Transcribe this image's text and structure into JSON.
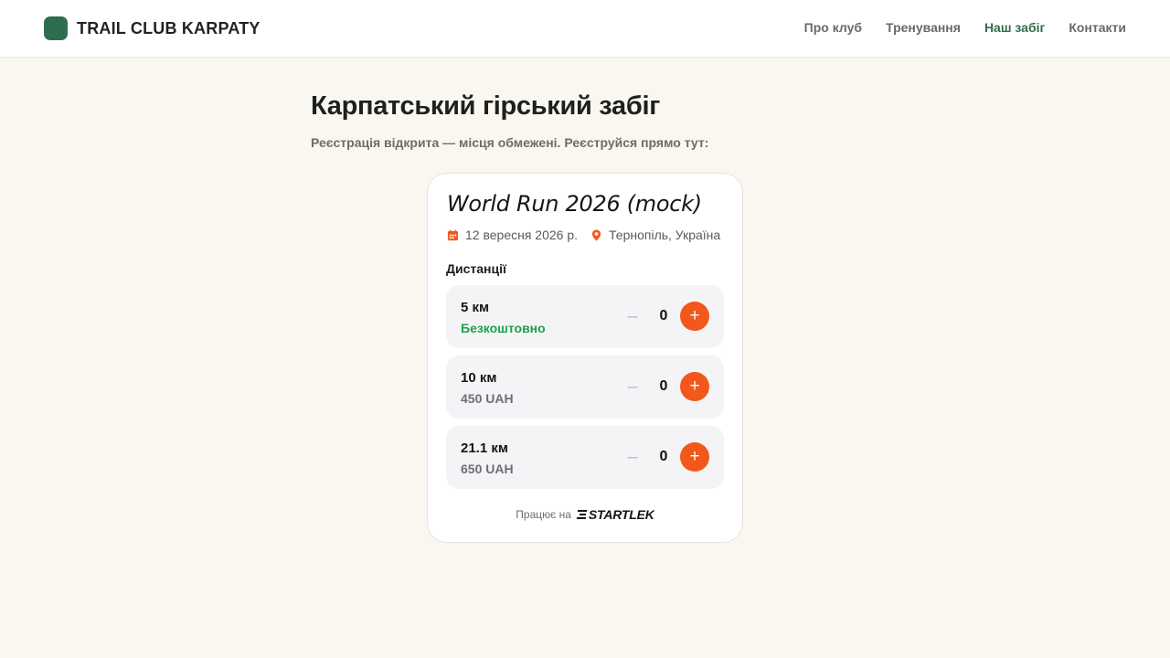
{
  "brand": {
    "name": "TRAIL CLUB KARPATY",
    "logo_color": "#2f6d4f"
  },
  "nav": {
    "items": [
      {
        "label": "Про клуб",
        "active": false
      },
      {
        "label": "Тренування",
        "active": false
      },
      {
        "label": "Наш забіг",
        "active": true
      },
      {
        "label": "Контакти",
        "active": false
      }
    ]
  },
  "page": {
    "title": "Карпатський гірський забіг",
    "subtitle": "Реєстрація відкрита — місця обмежені. Реєструйся прямо тут:"
  },
  "widget": {
    "event_title": "World Run 2026 (mock)",
    "date": "12 вересня 2026 р.",
    "date_icon": "calendar-icon",
    "location": "Тернопіль, Україна",
    "location_icon": "map-pin-icon",
    "section_label": "Дистанції",
    "distances": [
      {
        "name": "5 км",
        "price": "Безкоштовно",
        "quantity": "0"
      },
      {
        "name": "10 км",
        "price": "450 UAH",
        "quantity": "0"
      },
      {
        "name": "21.1 км",
        "price": "650 UAH",
        "quantity": "0"
      }
    ],
    "minus_symbol": "–",
    "plus_symbol": "+",
    "powered_by_label": "Працює на",
    "powered_by_brand": "STARTLEK"
  },
  "colors": {
    "accent": "#f2571c",
    "brand_green": "#2f6d4f",
    "free_green": "#1aa345",
    "background": "#faf7f1"
  }
}
